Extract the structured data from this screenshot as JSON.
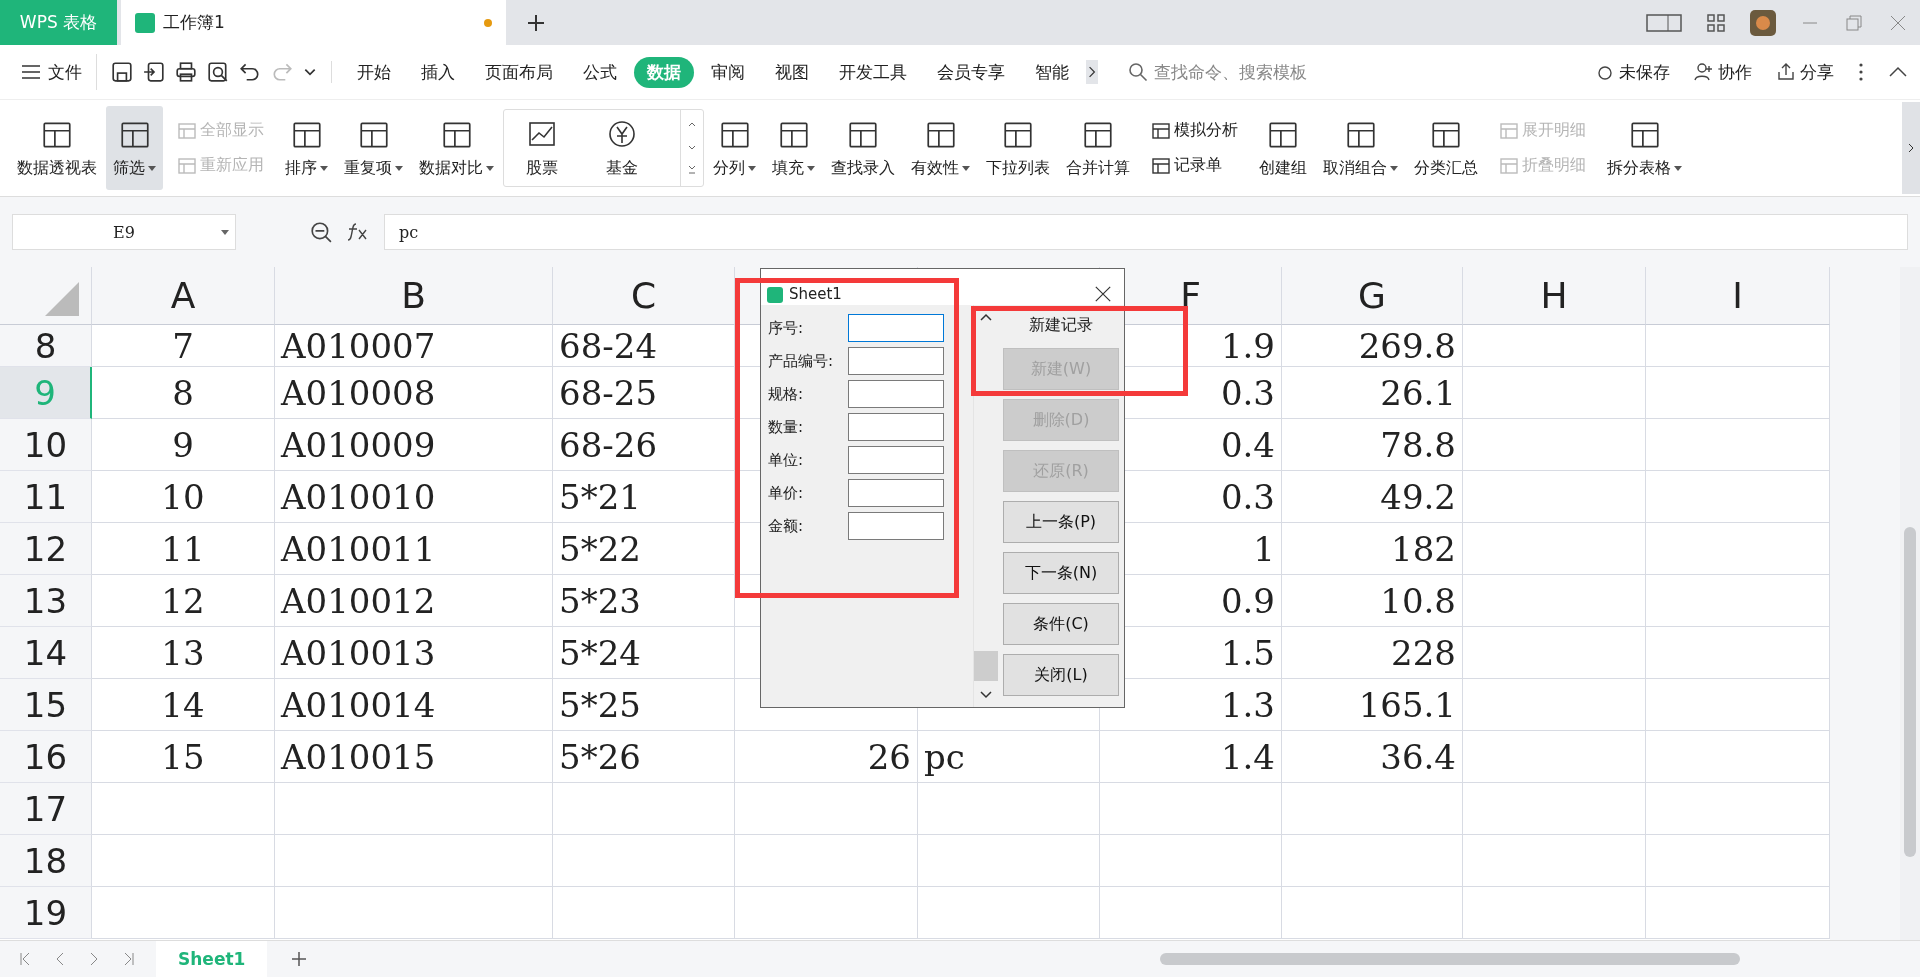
{
  "app_tab": "WPS 表格",
  "doc_tab": {
    "title": "工作簿1",
    "unsaved": true
  },
  "menu": {
    "file": "文件",
    "tabs": [
      {
        "label": "开始",
        "selected": false
      },
      {
        "label": "插入",
        "selected": false
      },
      {
        "label": "页面布局",
        "selected": false
      },
      {
        "label": "公式",
        "selected": false
      },
      {
        "label": "数据",
        "selected": true
      },
      {
        "label": "审阅",
        "selected": false
      },
      {
        "label": "视图",
        "selected": false
      },
      {
        "label": "开发工具",
        "selected": false
      },
      {
        "label": "会员专享",
        "selected": false
      },
      {
        "label": "智能",
        "selected": false
      }
    ],
    "search_placeholder": "查找命令、搜索模板",
    "actions": [
      "未保存",
      "协作",
      "分享"
    ]
  },
  "ribbon": [
    {
      "kind": "big",
      "label": "数据透视表",
      "dropdown": false,
      "pressed": false
    },
    {
      "kind": "big",
      "label": "筛选",
      "dropdown": true,
      "pressed": true
    },
    {
      "kind": "pair",
      "items": [
        {
          "label": "全部显示",
          "disabled": true
        },
        {
          "label": "重新应用",
          "disabled": true
        }
      ]
    },
    {
      "kind": "big",
      "label": "排序",
      "dropdown": true,
      "pressed": false
    },
    {
      "kind": "big",
      "label": "重复项",
      "dropdown": true,
      "pressed": false
    },
    {
      "kind": "big",
      "label": "数据对比",
      "dropdown": true,
      "pressed": false
    },
    {
      "kind": "gallery",
      "items": [
        "股票",
        "基金"
      ]
    },
    {
      "kind": "big",
      "label": "分列",
      "dropdown": true,
      "pressed": false
    },
    {
      "kind": "big",
      "label": "填充",
      "dropdown": true,
      "pressed": false
    },
    {
      "kind": "big",
      "label": "查找录入",
      "dropdown": false,
      "pressed": false
    },
    {
      "kind": "big",
      "label": "有效性",
      "dropdown": true,
      "pressed": false
    },
    {
      "kind": "big",
      "label": "下拉列表",
      "dropdown": false,
      "pressed": false
    },
    {
      "kind": "big",
      "label": "合并计算",
      "dropdown": false,
      "pressed": false
    },
    {
      "kind": "pair",
      "items": [
        {
          "label": "模拟分析",
          "disabled": false
        },
        {
          "label": "记录单",
          "disabled": false
        }
      ]
    },
    {
      "kind": "big",
      "label": "创建组",
      "dropdown": false,
      "pressed": false
    },
    {
      "kind": "big",
      "label": "取消组合",
      "dropdown": true,
      "pressed": false
    },
    {
      "kind": "big",
      "label": "分类汇总",
      "dropdown": false,
      "pressed": false
    },
    {
      "kind": "pair",
      "items": [
        {
          "label": "展开明细",
          "disabled": true
        },
        {
          "label": "折叠明细",
          "disabled": true
        }
      ]
    },
    {
      "kind": "big",
      "label": "拆分表格",
      "dropdown": true,
      "pressed": false
    }
  ],
  "formula_bar": {
    "cell_ref": "E9",
    "value": "pc"
  },
  "columns": [
    "A",
    "B",
    "C",
    null,
    null,
    "F",
    "G",
    "H",
    "I"
  ],
  "rows": [
    {
      "label": "8",
      "selected": false,
      "cells": [
        "7",
        "A010007",
        "68-24",
        null,
        null,
        "1.9",
        "269.8"
      ]
    },
    {
      "label": "9",
      "selected": true,
      "cells": [
        "8",
        "A010008",
        "68-25",
        null,
        null,
        "0.3",
        "26.1"
      ]
    },
    {
      "label": "10",
      "selected": false,
      "cells": [
        "9",
        "A010009",
        "68-26",
        null,
        null,
        "0.4",
        "78.8"
      ]
    },
    {
      "label": "11",
      "selected": false,
      "cells": [
        "10",
        "A010010",
        "5*21",
        null,
        null,
        "0.3",
        "49.2"
      ]
    },
    {
      "label": "12",
      "selected": false,
      "cells": [
        "11",
        "A010011",
        "5*22",
        null,
        null,
        "1",
        "182"
      ]
    },
    {
      "label": "13",
      "selected": false,
      "cells": [
        "12",
        "A010012",
        "5*23",
        null,
        null,
        "0.9",
        "10.8"
      ]
    },
    {
      "label": "14",
      "selected": false,
      "cells": [
        "13",
        "A010013",
        "5*24",
        null,
        null,
        "1.5",
        "228"
      ]
    },
    {
      "label": "15",
      "selected": false,
      "cells": [
        "14",
        "A010014",
        "5*25",
        null,
        null,
        "1.3",
        "165.1"
      ]
    },
    {
      "label": "16",
      "selected": false,
      "cells": [
        "15",
        "A010015",
        "5*26",
        "26",
        "pc",
        "1.4",
        "36.4"
      ]
    },
    {
      "label": "17",
      "selected": false,
      "cells": [
        null,
        null,
        null,
        null,
        null,
        null,
        null
      ]
    },
    {
      "label": "18",
      "selected": false,
      "cells": [
        null,
        null,
        null,
        null,
        null,
        null,
        null
      ]
    },
    {
      "label": "19",
      "selected": false,
      "cells": [
        null,
        null,
        null,
        null,
        null,
        null,
        null
      ]
    }
  ],
  "dialog": {
    "title": "Sheet1",
    "fields": [
      {
        "label": "序号:",
        "focused": true
      },
      {
        "label": "产品编号:",
        "focused": false
      },
      {
        "label": "规格:",
        "focused": false
      },
      {
        "label": "数量:",
        "focused": false
      },
      {
        "label": "单位:",
        "focused": false
      },
      {
        "label": "单价:",
        "focused": false
      },
      {
        "label": "金额:",
        "focused": false
      }
    ],
    "status": "新建记录",
    "buttons": [
      {
        "label": "新建(W)",
        "disabled": true
      },
      {
        "label": "删除(D)",
        "disabled": true
      },
      {
        "label": "还原(R)",
        "disabled": true
      },
      {
        "label": "上一条(P)",
        "disabled": false
      },
      {
        "label": "下一条(N)",
        "disabled": false
      },
      {
        "label": "条件(C)",
        "disabled": false
      },
      {
        "label": "关闭(L)",
        "disabled": false
      }
    ]
  },
  "sheet_tabs": [
    {
      "label": "Sheet1",
      "selected": true
    }
  ]
}
